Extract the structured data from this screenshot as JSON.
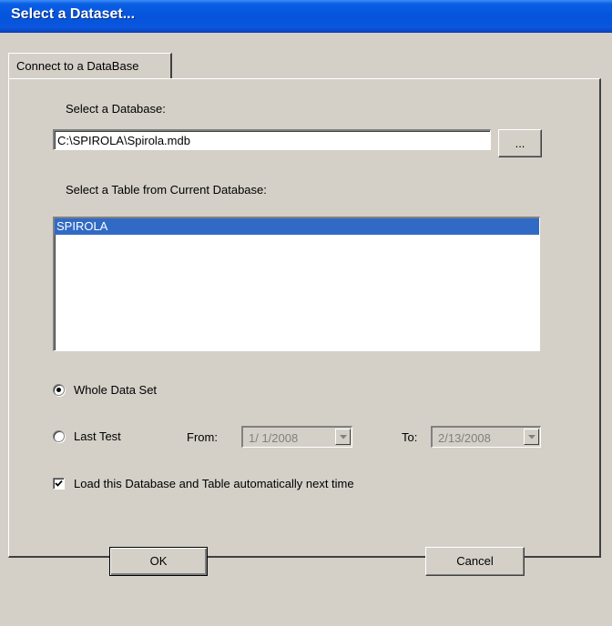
{
  "window": {
    "title": "Select a Dataset..."
  },
  "tab": {
    "label": "Connect to a DataBase"
  },
  "database": {
    "label": "Select a Database:",
    "path": "C:\\SPIROLA\\Spirola.mdb",
    "browse_label": "..."
  },
  "table": {
    "label": "Select a Table from Current Database:",
    "items": [
      "SPIROLA"
    ],
    "selected": "SPIROLA"
  },
  "options": {
    "whole_data_set_label": "Whole Data Set",
    "whole_data_set_checked": true,
    "last_test_label": "Last Test",
    "last_test_checked": false,
    "from_label": "From:",
    "from_value": "1/ 1/2008",
    "to_label": "To:",
    "to_value": "2/13/2008",
    "autoload_label": "Load this Database and Table automatically next time",
    "autoload_checked": true
  },
  "buttons": {
    "ok": "OK",
    "cancel": "Cancel"
  },
  "colors": {
    "selection": "#316ac5",
    "titlebar": "#0554dc",
    "face": "#d4d0c8"
  }
}
